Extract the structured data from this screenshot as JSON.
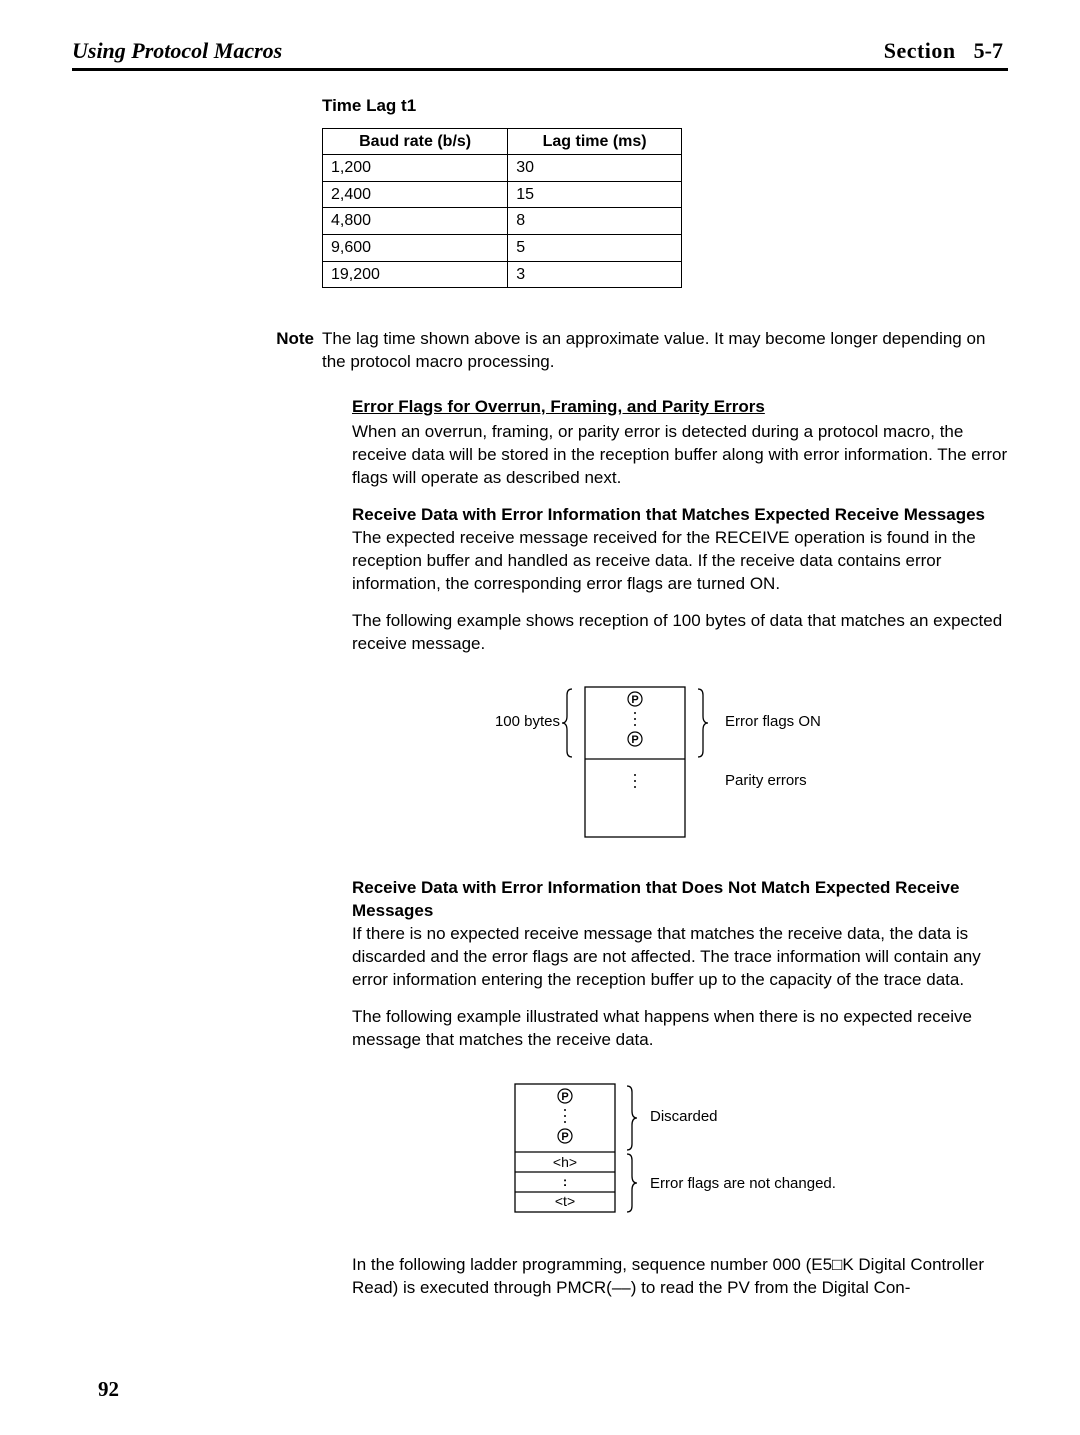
{
  "header": {
    "left_title": "Using Protocol Macros",
    "section_label": "Section",
    "section_number": "5-7"
  },
  "subhead_time_lag": "Time Lag t1",
  "table": {
    "headers": [
      "Baud rate (b/s)",
      "Lag time (ms)"
    ],
    "rows": [
      [
        "1,200",
        "30"
      ],
      [
        "2,400",
        "15"
      ],
      [
        "4,800",
        "8"
      ],
      [
        "9,600",
        "5"
      ],
      [
        "19,200",
        "3"
      ]
    ]
  },
  "note_label": "Note",
  "note_text": "The lag time shown above is an approximate value. It may become longer depending on the protocol macro processing.",
  "error_heading": "Error Flags for Overrun, Framing, and Parity Errors",
  "error_para": "When an overrun, framing, or parity error is detected during a protocol macro, the receive data will be stored in the reception buffer along with error information. The error flags will operate as described next.",
  "match_heading": "Receive Data with Error Information that Matches Expected Receive Messages",
  "match_para": "The expected receive message received for the RECEIVE operation is found in the reception buffer and handled as receive data. If the receive data contains error information, the corresponding error flags are turned ON.",
  "match_example_intro": "The following example shows reception of 100 bytes of data that matches an expected receive message.",
  "diagram1": {
    "left_label": "100 bytes",
    "right_label_top": "Error flags ON",
    "right_label_bottom": "Parity errors"
  },
  "nomatch_heading": "Receive Data with Error Information that Does Not Match Expected Receive Messages",
  "nomatch_para": "If there is no expected receive message that matches the receive data, the data is discarded and the error flags are not affected. The trace information will contain any error information entering the reception buffer up to the capacity of the trace data.",
  "nomatch_example_intro": "The following example illustrated what happens when there is no expected receive message that matches the receive data.",
  "diagram2": {
    "right_label_top": "Discarded",
    "right_label_bottom": "Error flags are not changed.",
    "row_h": "<h>",
    "row_t": "<t>"
  },
  "ladder_para": "In the following ladder programming, sequence number 000 (E5□K Digital Controller Read) is executed through PMCR(––) to read the PV from the Digital Con-",
  "page_number": "92"
}
